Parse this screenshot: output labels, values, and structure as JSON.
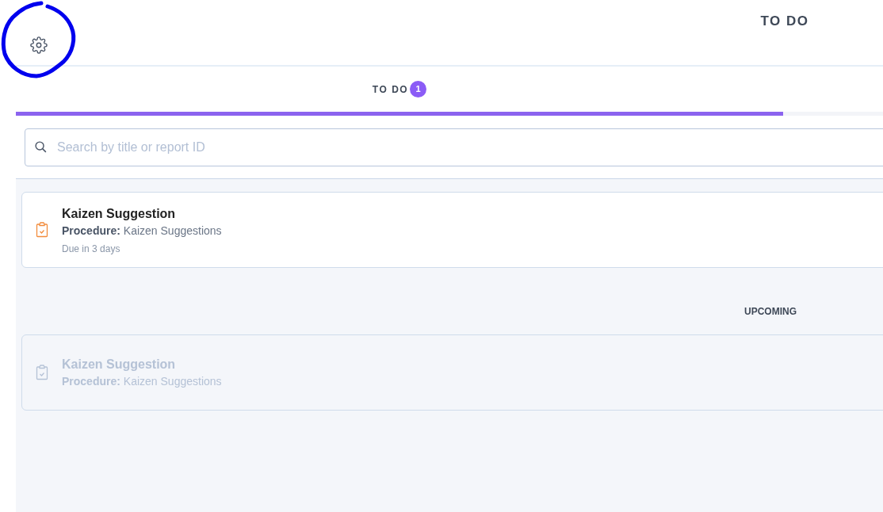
{
  "header": {
    "title": "TO DO"
  },
  "tabs": [
    {
      "label": "TO DO",
      "count": "1",
      "selected": true
    }
  ],
  "search": {
    "placeholder": "Search by title or report ID"
  },
  "todo_items": [
    {
      "title": "Kaizen Suggestion",
      "procedure_label": "Procedure:",
      "procedure": "Kaizen Suggestions",
      "due": "Due in 3 days",
      "disabled": false
    }
  ],
  "upcoming": {
    "heading": "UPCOMING",
    "items": [
      {
        "title": "Kaizen Suggestion",
        "procedure_label": "Procedure:",
        "procedure": "Kaizen Suggestions",
        "disabled": true
      }
    ]
  }
}
